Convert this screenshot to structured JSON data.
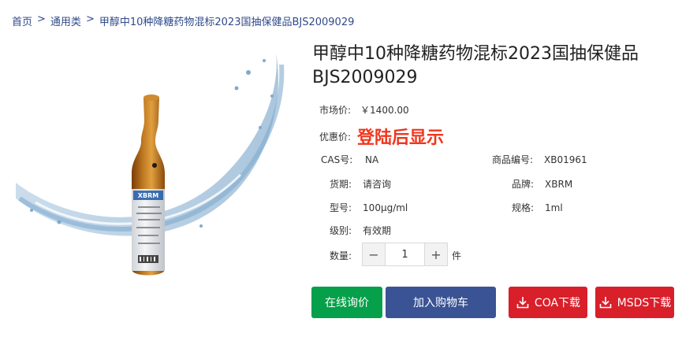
{
  "breadcrumb": {
    "home": "首页",
    "category": "通用类",
    "current": "甲醇中10种降糖药物混标2023国抽保健品BJS2009029",
    "separator": ">"
  },
  "product": {
    "title": "甲醇中10种降糖药物混标2023国抽保健品BJS2009029",
    "vial_label_brand": "XBRM",
    "market_price_label": "市场价:",
    "market_price": "￥1400.00",
    "promo_price_label": "优惠价:",
    "promo_price": "登陆后显示",
    "cas_label": "CAS号:",
    "cas": "NA",
    "code_label": "商品编号:",
    "code": "XB01961",
    "stock_label": "货期:",
    "stock": "请咨询",
    "brand_label": "品牌:",
    "brand": "XBRM",
    "model_label": "型号:",
    "model": "100µg/ml",
    "spec_label": "规格:",
    "spec": "1ml",
    "grade_label": "级别:",
    "grade": "有效期",
    "qty_label": "数量:",
    "qty_minus": "−",
    "qty_value": "1",
    "qty_plus": "+",
    "qty_unit": "件"
  },
  "actions": {
    "inquiry": "在线询价",
    "cart": "加入购物车",
    "coa": "COA下载",
    "msds": "MSDS下载"
  },
  "colors": {
    "link": "#2f4a8a",
    "promo": "#f0361d",
    "inquiry_bg": "#06a04a",
    "cart_bg": "#3a5394",
    "download_bg": "#d91f2a"
  }
}
